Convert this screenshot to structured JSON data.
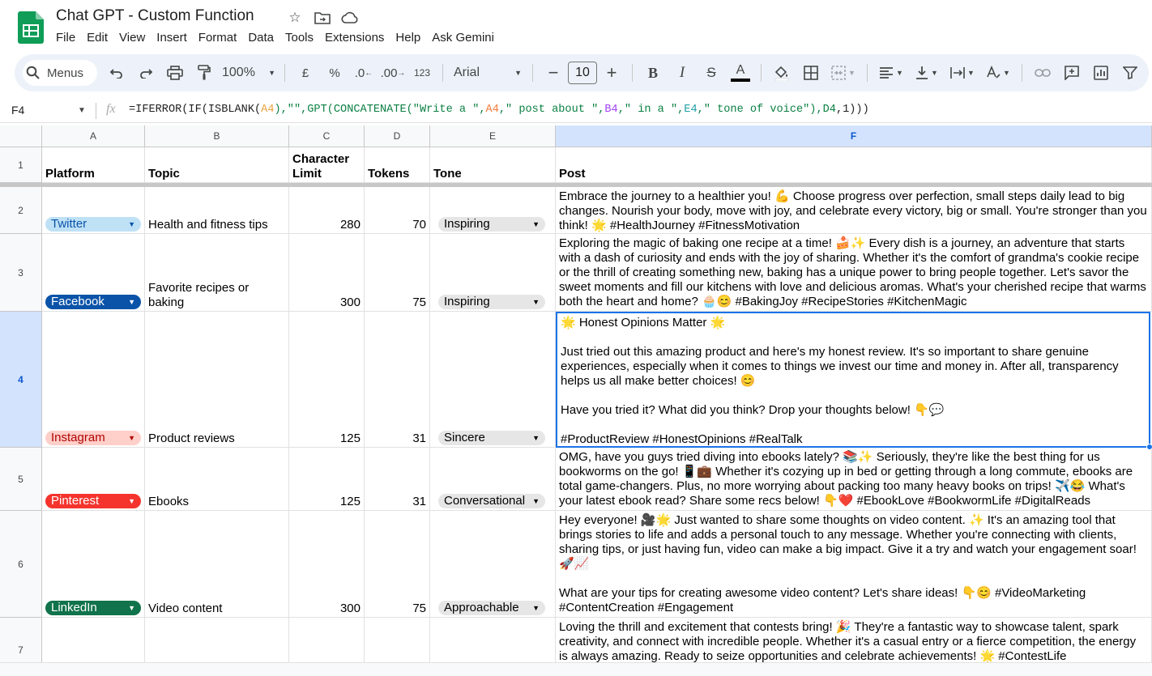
{
  "doc": {
    "title": "Chat GPT - Custom Function"
  },
  "menu": [
    "File",
    "Edit",
    "View",
    "Insert",
    "Format",
    "Data",
    "Tools",
    "Extensions",
    "Help",
    "Ask Gemini"
  ],
  "toolbar": {
    "menus_label": "Menus",
    "zoom": "100%",
    "currency": "£",
    "percent": "%",
    "dec_decrease": ".0",
    "dec_increase": ".00",
    "number_format": "123",
    "font": "Arial",
    "font_size": "10",
    "bold": "B",
    "italic": "I",
    "strike": "S",
    "text_color": "A"
  },
  "formula_bar": {
    "cell_ref": "F4",
    "fx": "fx",
    "parts": [
      "=IFERROR(IF(ISBLANK(",
      "A4",
      "),\"\",GPT(CONCATENATE(\"Write a \",",
      "A4",
      ",\" post about \",",
      "B4",
      ",\" in a \",",
      "E4",
      ",\" tone of voice\"),",
      "D4",
      ",1)))"
    ]
  },
  "columns": [
    "A",
    "B",
    "C",
    "D",
    "E",
    "F"
  ],
  "rows": [
    "1",
    "2",
    "3",
    "4",
    "5",
    "6",
    "7"
  ],
  "header": {
    "platform": "Platform",
    "topic": "Topic",
    "character_limit": "Character Limit",
    "tokens": "Tokens",
    "tone": "Tone",
    "post": "Post"
  },
  "data_rows": [
    {
      "platform": "Twitter",
      "topic": "Health and fitness tips",
      "char_limit": "280",
      "tokens": "70",
      "tone": "Inspiring",
      "post": "Embrace the journey to a healthier you! 💪 Choose progress over perfection, small steps daily lead to big changes. Nourish your body, move with joy, and celebrate every victory, big or small. You're stronger than you think! 🌟 #HealthJourney #FitnessMotivation"
    },
    {
      "platform": "Facebook",
      "topic": "Favorite recipes or baking",
      "char_limit": "300",
      "tokens": "75",
      "tone": "Inspiring",
      "post": "Exploring the magic of baking one recipe at a time! 🍰✨ Every dish is a journey, an adventure that starts with a dash of curiosity and ends with the joy of sharing. Whether it's the comfort of grandma's cookie recipe or the thrill of creating something new, baking has a unique power to bring people together. Let's savor the sweet moments and fill our kitchens with love and delicious aromas. What's your cherished recipe that warms both the heart and home? 🧁😊 #BakingJoy #RecipeStories #KitchenMagic"
    },
    {
      "platform": "Instagram",
      "topic": "Product reviews",
      "char_limit": "125",
      "tokens": "31",
      "tone": "Sincere",
      "post": "🌟 Honest Opinions Matter 🌟\n\nJust tried out this amazing product and here's my honest review. It's so important to share genuine experiences, especially when it comes to things we invest our time and money in. After all, transparency helps us all make better choices! 😊\n\nHave you tried it? What did you think? Drop your thoughts below! 👇💬\n\n#ProductReview #HonestOpinions #RealTalk"
    },
    {
      "platform": "Pinterest",
      "topic": "Ebooks",
      "char_limit": "125",
      "tokens": "31",
      "tone": "Conversational",
      "post": "OMG, have you guys tried diving into ebooks lately? 📚✨ Seriously, they're like the best thing for us bookworms on the go! 📱💼 Whether it's cozying up in bed or getting through a long commute, ebooks are total game-changers. Plus, no more worrying about packing too many heavy books on trips! ✈️😂 What's your latest ebook read? Share some recs below! 👇❤️ #EbookLove #BookwormLife #DigitalReads"
    },
    {
      "platform": "LinkedIn",
      "topic": "Video content",
      "char_limit": "300",
      "tokens": "75",
      "tone": "Approachable",
      "post": "Hey everyone! 🎥🌟 Just wanted to share some thoughts on video content. ✨ It's an amazing tool that brings stories to life and adds a personal touch to any message. Whether you're connecting with clients, sharing tips, or just having fun, video can make a big impact. Give it a try and watch your engagement soar! 🚀📈\n\nWhat are your tips for creating awesome video content? Let's share ideas! 👇😊 #VideoMarketing #ContentCreation #Engagement"
    },
    {
      "platform": "",
      "topic": "",
      "char_limit": "",
      "tokens": "",
      "tone": "",
      "post": "Loving the thrill and excitement that contests bring! 🎉 They're a fantastic way to showcase talent, spark creativity, and connect with incredible people. Whether it's a casual entry or a fierce competition, the energy is always amazing. Ready to seize opportunities and celebrate achievements! 🌟 #ContestLife"
    }
  ]
}
